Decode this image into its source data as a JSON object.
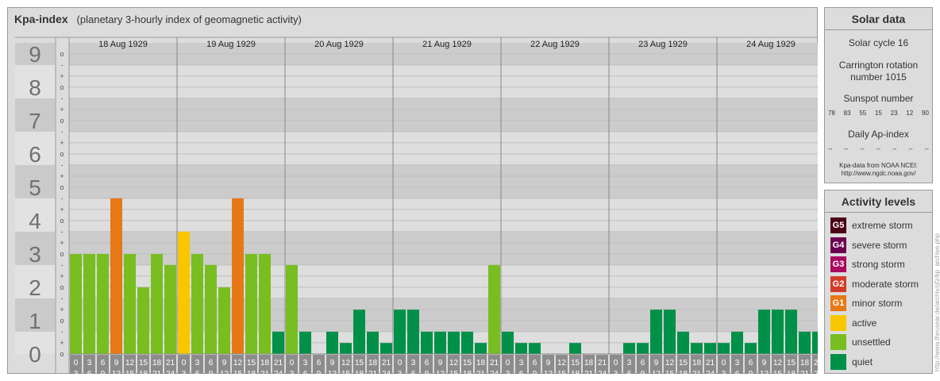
{
  "chart_data": {
    "type": "bar",
    "title": "Kpa-index",
    "subtitle": "(planetary 3-hourly index of geomagnetic activity)",
    "y_ticks": [
      "0",
      "1",
      "2",
      "3",
      "4",
      "5",
      "6",
      "7",
      "8",
      "9"
    ],
    "y_sub_ticks": [
      "-",
      "o",
      "+"
    ],
    "ylim": [
      0,
      9.33
    ],
    "days": [
      "18 Aug 1929",
      "19 Aug 1929",
      "20 Aug 1929",
      "21 Aug 1929",
      "22 Aug 1929",
      "23 Aug 1929",
      "24 Aug 1929"
    ],
    "interval_starts": [
      "0",
      "3",
      "6",
      "9",
      "12",
      "15",
      "18",
      "21"
    ],
    "interval_ends": [
      "3",
      "6",
      "9",
      "12",
      "15",
      "18",
      "21",
      "24"
    ],
    "values": [
      [
        3.0,
        3.0,
        3.0,
        4.67,
        3.0,
        2.0,
        3.0,
        2.67
      ],
      [
        3.67,
        3.0,
        2.67,
        2.0,
        4.67,
        3.0,
        3.0,
        0.67
      ],
      [
        2.67,
        0.67,
        0.0,
        0.67,
        0.33,
        1.33,
        0.67,
        0.33
      ],
      [
        1.33,
        1.33,
        0.67,
        0.67,
        0.67,
        0.67,
        0.33,
        2.67
      ],
      [
        0.67,
        0.33,
        0.33,
        0.0,
        0.0,
        0.33,
        0.0,
        0.0
      ],
      [
        0.0,
        0.33,
        0.33,
        1.33,
        1.33,
        0.67,
        0.33,
        0.33
      ],
      [
        0.33,
        0.67,
        0.33,
        1.33,
        1.33,
        1.33,
        0.67,
        0.67
      ]
    ],
    "grid": true,
    "colors": {
      "G5": "#4b0018",
      "G4": "#6d0050",
      "G3": "#a80a60",
      "G2": "#d23c28",
      "G1": "#e77818",
      "active": "#f9c600",
      "unsettled": "#78be20",
      "quiet": "#009048"
    }
  },
  "solar": {
    "title": "Solar data",
    "cycle": "Solar cycle 16",
    "carrington_line1": "Carrington rotation",
    "carrington_line2": "number 1015",
    "sunspot_title": "Sunspot number",
    "sunspots": [
      "78",
      "83",
      "55",
      "15",
      "23",
      "12",
      "90"
    ],
    "ap_title": "Daily Ap-index",
    "ap_values": [
      "--",
      "--",
      "--",
      "--",
      "--",
      "--",
      "--"
    ],
    "source_line1": "Kpa-data from NOAA NCEI:",
    "source_line2": "http://www.ngdc.noaa.gov/"
  },
  "activity": {
    "title": "Activity levels",
    "items": [
      {
        "badge": "G5",
        "label": "extreme storm",
        "color": "#4b0018"
      },
      {
        "badge": "G4",
        "label": "severe storm",
        "color": "#6d0050"
      },
      {
        "badge": "G3",
        "label": "strong storm",
        "color": "#a80a60"
      },
      {
        "badge": "G2",
        "label": "moderate storm",
        "color": "#d23c28"
      },
      {
        "badge": "G1",
        "label": "minor storm",
        "color": "#e77818"
      },
      {
        "badge": "",
        "label": "active",
        "color": "#f9c600"
      },
      {
        "badge": "",
        "label": "unsettled",
        "color": "#78be20"
      },
      {
        "badge": "",
        "label": "quiet",
        "color": "#009048"
      }
    ]
  },
  "watermark": "http://www.theusear.de/archiv/gfz/kp_archive.php"
}
